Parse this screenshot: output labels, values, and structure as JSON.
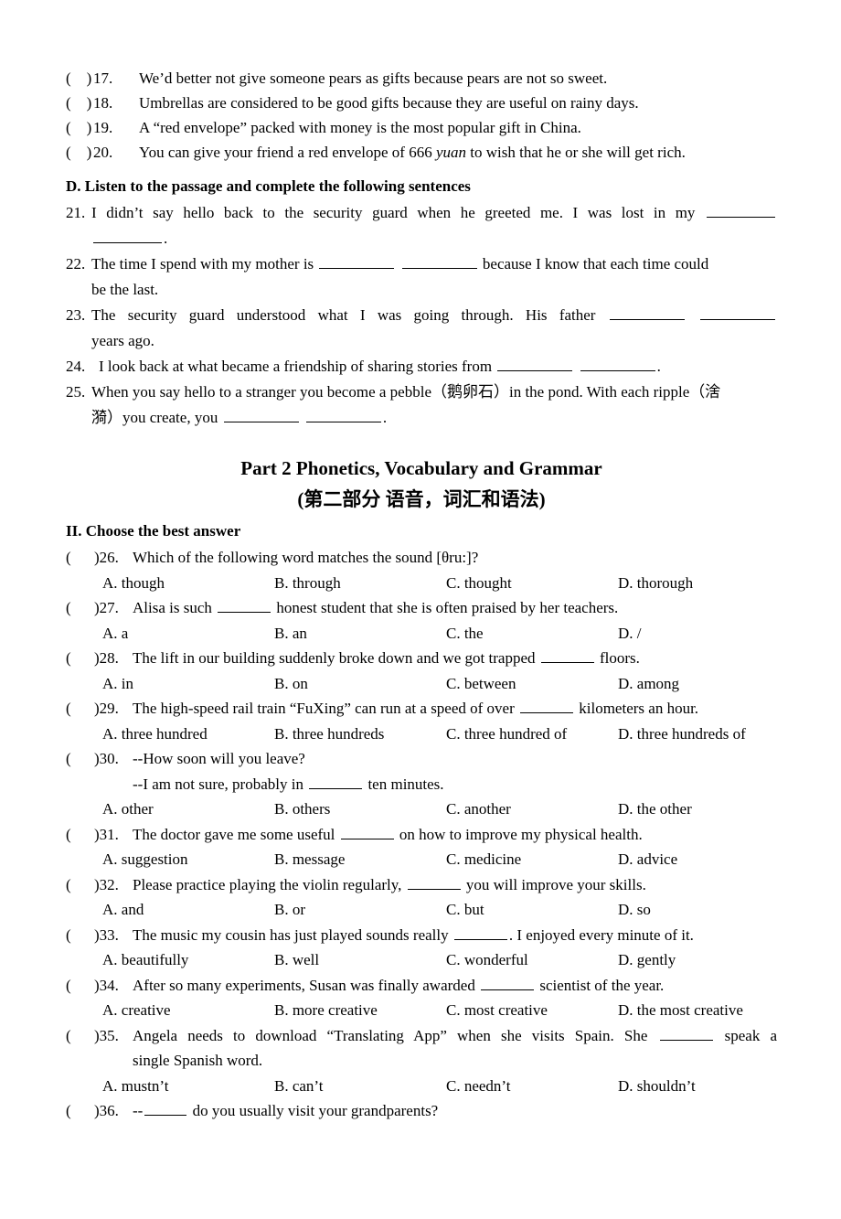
{
  "truefalse_items": [
    {
      "num": "17.",
      "text": "We’d better not give someone pears as gifts because pears are not so sweet."
    },
    {
      "num": "18.",
      "text": "Umbrellas are considered to be good gifts because they are useful on rainy days."
    },
    {
      "num": "19.",
      "text": "A “red envelope” packed with money is the most popular gift in China."
    },
    {
      "num": "20a",
      "text": "You can give your friend a red envelope of 666 "
    },
    {
      "num": "20b",
      "text": "yuan"
    },
    {
      "num": "20c",
      "text": " to wish that he or she will get rich."
    }
  ],
  "section_d": {
    "heading": "D. Listen to the passage and complete the following sentences",
    "q21": {
      "num": "21.",
      "line1": "I didn’t say hello back to the security guard when he greeted me. I was lost in my",
      "line2_tail": "."
    },
    "q22": {
      "num": "22.",
      "part1": "The time I spend with my mother is",
      "part2": "because I know that each time could",
      "line2": "be the last."
    },
    "q23": {
      "num": "23.",
      "part1": "The security guard understood what I was going through. His father",
      "line2": "years ago."
    },
    "q24": {
      "num": "24.",
      "part1": "I look back at what became a friendship of sharing stories from",
      "tail": "."
    },
    "q25": {
      "num": "25.",
      "part1": "When you say hello to a stranger you become a pebble（鹅卵石）in the pond. With each ripple（涻",
      "line2_a": "漪）you create, you",
      "tail": "."
    }
  },
  "part2": {
    "title": "Part 2 Phonetics, Vocabulary and Grammar",
    "subtitle": "(第二部分 语音，词汇和语法)",
    "section_heading": "II. Choose the best answer",
    "paren": "(",
    "questions": [
      {
        "num": ")26.",
        "stem_before": "Which of the following word matches the sound [θru:]?",
        "stem_after": "",
        "options": [
          "A. though",
          "B. through",
          "C. thought",
          "D. thorough"
        ]
      },
      {
        "num": ")27.",
        "stem_before": "Alisa is such",
        "stem_after": "honest student that she is often praised by her teachers.",
        "options": [
          "A. a",
          "B. an",
          "C. the",
          "D. /"
        ]
      },
      {
        "num": ")28.",
        "stem_before": "The lift in our building suddenly broke down and we got trapped",
        "stem_after": "floors.",
        "options": [
          "A. in",
          "B. on",
          "C. between",
          "D. among"
        ]
      },
      {
        "num": ")29.",
        "stem_before": "The high-speed rail train “FuXing” can run at a speed of over",
        "stem_after": "kilometers an hour.",
        "options": [
          "A. three hundred",
          "B. three hundreds",
          "C. three hundred of",
          "D. three hundreds of"
        ]
      },
      {
        "num": ")30.",
        "stem_before": "--How soon will you leave?",
        "stem_after": "",
        "sub_before": "--I am not sure, probably in",
        "sub_after": "ten minutes.",
        "options": [
          "A. other",
          "B. others",
          "C. another",
          "D. the other"
        ]
      },
      {
        "num": ")31.",
        "stem_before": "The doctor gave me some useful",
        "stem_after": "on how to improve my physical health.",
        "options": [
          "A. suggestion",
          "B. message",
          "C. medicine",
          "D. advice"
        ]
      },
      {
        "num": ")32.",
        "stem_before": "Please practice playing the violin regularly,",
        "stem_after": "you will improve your skills.",
        "options": [
          "A. and",
          "B. or",
          "C. but",
          "D. so"
        ]
      },
      {
        "num": ")33.",
        "stem_before": "The music my cousin has just played sounds really",
        "stem_after": ". I enjoyed every minute of it.",
        "options": [
          "A. beautifully",
          "B. well",
          "C. wonderful",
          "D. gently"
        ]
      },
      {
        "num": ")34.",
        "stem_before": "After so many experiments, Susan was finally awarded",
        "stem_after": "scientist of the year.",
        "options": [
          "A. creative",
          "B. more creative",
          "C. most creative",
          "D. the most creative"
        ]
      },
      {
        "num": ")35.",
        "stem_before": "Angela needs to download “Translating App” when she visits Spain. She",
        "stem_after": "speak a",
        "sub_line": "single Spanish word.",
        "options": [
          "A. mustn’t",
          "B. can’t",
          "C. needn’t",
          "D. shouldn’t"
        ]
      },
      {
        "num": ")36.",
        "stem_before": "--",
        "stem_after": "do you usually visit your grandparents?",
        "options": []
      }
    ]
  }
}
